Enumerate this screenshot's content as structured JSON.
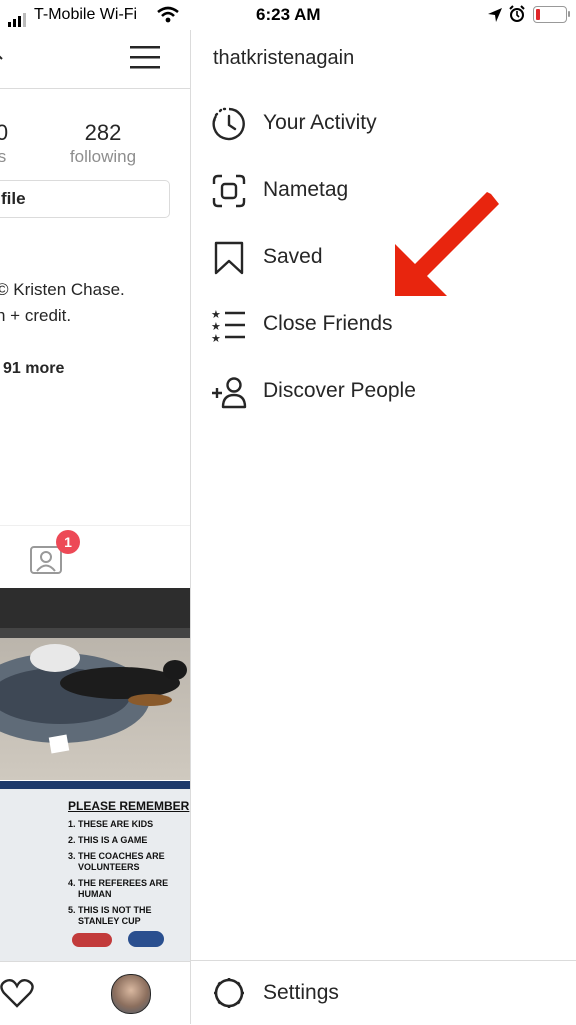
{
  "status_bar": {
    "carrier": "T-Mobile Wi-Fi",
    "time": "6:23 AM"
  },
  "profile": {
    "posts_count_partial": "0",
    "posts_label_partial": "s",
    "following_count": "282",
    "following_label": "following",
    "edit_button_partial": "file",
    "bio_line1": "© Kristen Chase.",
    "bio_line2": "n + credit.",
    "followed_by_partial": "91 more",
    "tagged_badge": "1",
    "sign": {
      "title": "PLEASE REMEMBER",
      "items": [
        "1. THESE ARE KIDS",
        "2. THIS IS A GAME",
        "3. THE COACHES ARE",
        "VOLUNTEERS",
        "4. THE REFEREES ARE",
        "HUMAN",
        "5. THIS IS NOT THE",
        "STANLEY CUP"
      ]
    }
  },
  "menu": {
    "username": "thatkristenagain",
    "items": [
      {
        "label": "Your Activity",
        "icon": "activity-icon"
      },
      {
        "label": "Nametag",
        "icon": "nametag-icon"
      },
      {
        "label": "Saved",
        "icon": "bookmark-icon"
      },
      {
        "label": "Close Friends",
        "icon": "close-friends-icon"
      },
      {
        "label": "Discover People",
        "icon": "add-person-icon"
      }
    ],
    "settings_label": "Settings"
  },
  "annotation": {
    "arrow_color": "#e8250e"
  },
  "colors": {
    "badge": "#ed4956",
    "divider": "#dbdbdb",
    "text": "#262626",
    "muted": "#8e8e8e"
  }
}
